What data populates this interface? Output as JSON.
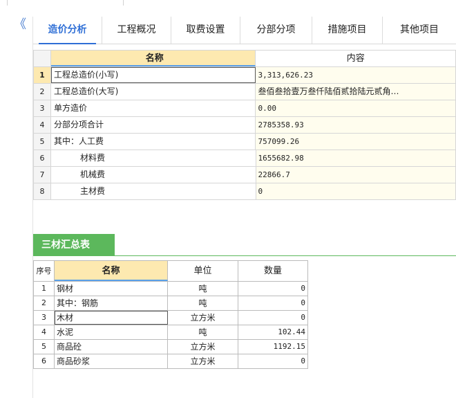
{
  "sidebar": {
    "collapse_glyph": "《"
  },
  "tabs": [
    {
      "label": "造价分析",
      "active": true
    },
    {
      "label": "工程概况"
    },
    {
      "label": "取费设置"
    },
    {
      "label": "分部分项"
    },
    {
      "label": "措施项目"
    },
    {
      "label": "其他项目"
    }
  ],
  "summary": {
    "headers": {
      "name": "名称",
      "value": "内容"
    },
    "rows": [
      {
        "idx": "1",
        "name": "工程总造价(小写)",
        "value": "3,313,626.23"
      },
      {
        "idx": "2",
        "name": "工程总造价(大写)",
        "value": "叁佰叁拾壹万叁仟陆佰贰拾陆元贰角…"
      },
      {
        "idx": "3",
        "name": "单方造价",
        "value": "0.00"
      },
      {
        "idx": "4",
        "name": "分部分项合计",
        "value": "2785358.93"
      },
      {
        "idx": "5",
        "name": "其中：人工费",
        "value": "757099.26"
      },
      {
        "idx": "6",
        "name": "材料费",
        "value": "1655682.98"
      },
      {
        "idx": "7",
        "name": "机械费",
        "value": "22866.7"
      },
      {
        "idx": "8",
        "name": "主材费",
        "value": "0"
      }
    ]
  },
  "materials": {
    "tab_label": "三材汇总表",
    "headers": {
      "seq": "序号",
      "name": "名称",
      "unit": "单位",
      "qty": "数量"
    },
    "rows": [
      {
        "seq": "1",
        "name": "钢材",
        "unit": "吨",
        "qty": "0"
      },
      {
        "seq": "2",
        "name": "其中：钢筋",
        "unit": "吨",
        "qty": "0"
      },
      {
        "seq": "3",
        "name": "木材",
        "unit": "立方米",
        "qty": "0"
      },
      {
        "seq": "4",
        "name": "水泥",
        "unit": "吨",
        "qty": "102.44"
      },
      {
        "seq": "5",
        "name": "商品砼",
        "unit": "立方米",
        "qty": "1192.15"
      },
      {
        "seq": "6",
        "name": "商品砂浆",
        "unit": "立方米",
        "qty": "0"
      }
    ]
  },
  "colors": {
    "accent": "#2f6fd6",
    "section_green": "#5cb85c",
    "header_highlight": "#fde9b0"
  }
}
